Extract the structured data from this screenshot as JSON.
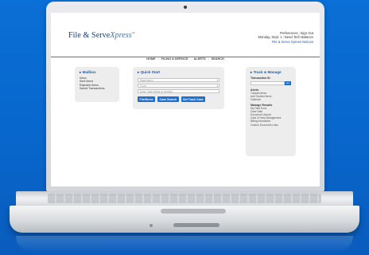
{
  "header": {
    "logo_main": "File & Serve",
    "logo_italic": "Xpress",
    "logo_tm": "™",
    "links_row1": [
      "Preferences",
      "Sign Out"
    ],
    "links_row2": [
      "Monday, Sept. 1",
      "Need Tech Balance"
    ],
    "links_row3": "File & Serve Xpress Notices"
  },
  "nav": {
    "items": [
      "HOME",
      "FILING & SERVICE",
      "ALERTS",
      "SEARCH"
    ]
  },
  "mailbox": {
    "title": "▸ Mailbox",
    "items": [
      "Inbox",
      "Sent Items",
      "Rejected Items",
      "Saved Transactions"
    ]
  },
  "quick_start": {
    "title": "▸ Quick Start",
    "fields": [
      {
        "placeholder": "Washington",
        "has_caret": true
      },
      {
        "placeholder": "Court",
        "has_caret": true
      },
      {
        "placeholder": "Enter Case Name or Number",
        "has_caret": false
      }
    ],
    "buttons": [
      "File/Serve",
      "Case Search",
      "Set Track Case"
    ]
  },
  "track_manage": {
    "title": "▸ Track & Manage",
    "transaction_label": "Transaction ID",
    "go_label": "Go",
    "alerts_label": "Alerts",
    "alerts_items": [
      "Tracked Items",
      "Add Tracked Items",
      "Calendar"
    ],
    "manage_label": "Manage Results",
    "manage_items": [
      "My Filed Docs",
      "Case Data",
      "Document Upload",
      "Case & Party Management",
      "Billing Information",
      "Custom Document Links"
    ]
  },
  "colors": {
    "background": "#0a6fd6",
    "accent": "#1f6fd0",
    "link": "#1a5fb4"
  }
}
